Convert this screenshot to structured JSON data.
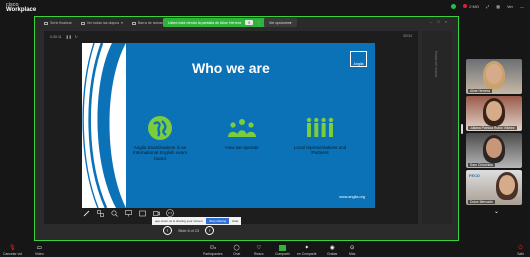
{
  "brand": {
    "line1": "cisco",
    "line2": "Workplace"
  },
  "top_bar": {
    "recording_label": "2 MO",
    "layout_label": "Ver"
  },
  "share_toolbar": {
    "items": [
      "Serie finalizar",
      "Ver todas las diapos",
      "Barra de tareas"
    ],
    "sharing_notice": "Usted está viendo la pantalla de Aline Herrera",
    "stop_label": "X",
    "view_options": "Ver opciones"
  },
  "presentation": {
    "time": "0:30:11",
    "slide_counter_top": "30/34",
    "side_panel_text": "Notas del orador"
  },
  "slide": {
    "title": "Who we are",
    "logo_text": "Anglia",
    "features": [
      {
        "text": "Anglia Examinations is an International English exam board",
        "icon": "globe-icon"
      },
      {
        "text": "How we operate",
        "icon": "group-icon"
      },
      {
        "text": "Local representatives and Partners",
        "icon": "people-row-icon"
      }
    ],
    "website": "www.anglia.org",
    "colors": {
      "background": "#0b72b7",
      "accent": "#7ccd3c"
    }
  },
  "browser_notice": {
    "text": "app.zoom.us is sharing your screen.",
    "allow_label": "Stop sharing",
    "hide_label": "Hide"
  },
  "slide_nav": {
    "label": "Slide 8 of 23"
  },
  "participants": [
    {
      "name": "Aline Herrera"
    },
    {
      "name": "Juliana Patricia Rubio Vilchez"
    },
    {
      "name": "Sam Chinchilla"
    },
    {
      "name": "Dulce Mercado",
      "logo": "FECD"
    }
  ],
  "bottom_bar": {
    "left": [
      {
        "label": "Cancelar vid"
      },
      {
        "label": "Video"
      }
    ],
    "center": [
      {
        "label": "Participantes",
        "count": "6"
      },
      {
        "label": "Chat"
      },
      {
        "label": "Reacc"
      },
      {
        "label": "Compartir"
      },
      {
        "label": "en Compartir"
      },
      {
        "label": "Grabar"
      },
      {
        "label": "Más"
      }
    ],
    "right": {
      "label": "Salir"
    }
  }
}
